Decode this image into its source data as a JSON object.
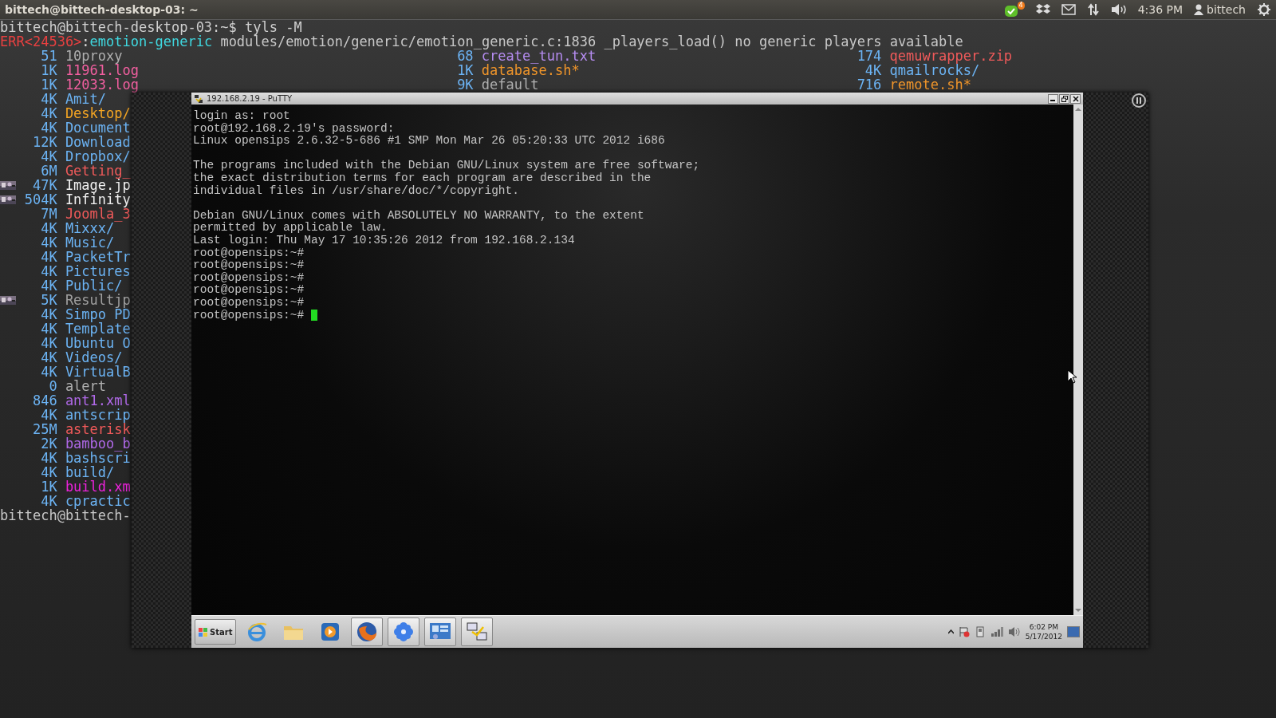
{
  "top_panel": {
    "title": "bittech@bittech-desktop-03: ~",
    "chat_badge": "4",
    "clock": "4:36 PM",
    "user": "bittech"
  },
  "terminal": {
    "prompt_line": "bittech@bittech-desktop-03:~$ tyls -M",
    "error": {
      "tag": "ERR<24536>",
      "separator": ":",
      "module": "emotion-generic",
      "message": "modules/emotion/generic/emotion_generic.c:1836 _players_load() no generic players available"
    },
    "listing": [
      [
        {
          "size": "51",
          "name": "10proxy",
          "kind": "plain"
        },
        {
          "size": "1K",
          "name": "11961.log",
          "kind": "log"
        },
        {
          "size": "1K",
          "name": "12033.log",
          "kind": "log"
        },
        {
          "size": "4K",
          "name": "Amit/",
          "kind": "dir"
        },
        {
          "size": "4K",
          "name": "Desktop/",
          "kind": "highlight"
        },
        {
          "size": "4K",
          "name": "Document",
          "kind": "dir"
        },
        {
          "size": "12K",
          "name": "Download",
          "kind": "dir"
        },
        {
          "size": "4K",
          "name": "Dropbox/",
          "kind": "dir"
        },
        {
          "size": "6M",
          "name": "Getting_",
          "kind": "archive"
        },
        {
          "size": "47K",
          "name": "Image.jp"
        },
        {
          "size": "504K",
          "name": "Infinity"
        },
        {
          "size": "7M",
          "name": "Joomla_3",
          "kind": "archive"
        },
        {
          "size": "4K",
          "name": "Mixxx/",
          "kind": "dir"
        },
        {
          "size": "4K",
          "name": "Music/",
          "kind": "dir"
        },
        {
          "size": "4K",
          "name": "PacketTr",
          "kind": "dir"
        },
        {
          "size": "4K",
          "name": "Pictures",
          "kind": "dir"
        },
        {
          "size": "4K",
          "name": "Public/",
          "kind": "dir"
        },
        {
          "size": "5K",
          "name": "Resultjp",
          "kind": "media"
        },
        {
          "size": "4K",
          "name": "Simpo PD",
          "kind": "dir"
        },
        {
          "size": "4K",
          "name": "Template",
          "kind": "dir"
        },
        {
          "size": "4K",
          "name": "Ubuntu O",
          "kind": "dir"
        },
        {
          "size": "4K",
          "name": "Videos/",
          "kind": "dir"
        },
        {
          "size": "4K",
          "name": "VirtualB",
          "kind": "dir"
        },
        {
          "size": "0",
          "name": "alert",
          "kind": "plain"
        },
        {
          "size": "846",
          "name": "ant1.xml",
          "kind": "xml"
        },
        {
          "size": "4K",
          "name": "antscrip",
          "kind": "dir"
        },
        {
          "size": "25M",
          "name": "asterisk",
          "kind": "archive"
        },
        {
          "size": "2K",
          "name": "bamboo_b",
          "kind": "xml"
        },
        {
          "size": "4K",
          "name": "bashscri",
          "kind": "dir"
        },
        {
          "size": "4K",
          "name": "build/",
          "kind": "dir"
        },
        {
          "size": "1K",
          "name": "build.xm",
          "kind": "build"
        },
        {
          "size": "4K",
          "name": "cpractic",
          "kind": "dir"
        }
      ],
      [
        {
          "size": "68",
          "name": "create_tun.txt",
          "kind": "text"
        },
        {
          "size": "1K",
          "name": "database.sh*",
          "kind": "script"
        },
        {
          "size": "9K",
          "name": "default",
          "kind": "plain"
        }
      ],
      [
        {
          "size": "174",
          "name": "qemuwrapper.zip",
          "kind": "archive"
        },
        {
          "size": "4K",
          "name": "qmailrocks/",
          "kind": "dir"
        },
        {
          "size": "716",
          "name": "remote.sh*",
          "kind": "script"
        }
      ]
    ],
    "next_prompt": "bittech@bittech-"
  },
  "putty": {
    "title": "192.168.2.19 - PuTTY",
    "blocks": [
      [
        "login as: root",
        "root@192.168.2.19's password:",
        "Linux opensips 2.6.32-5-686 #1 SMP Mon Mar 26 05:20:33 UTC 2012 i686"
      ],
      [
        "The programs included with the Debian GNU/Linux system are free software;",
        "the exact distribution terms for each program are described in the",
        "individual files in /usr/share/doc/*/copyright."
      ],
      [
        "Debian GNU/Linux comes with ABSOLUTELY NO WARRANTY, to the extent",
        "permitted by applicable law.",
        "Last login: Thu May 17 10:35:26 2012 from 192.168.2.134",
        "root@opensips:~#",
        "root@opensips:~#",
        "root@opensips:~#",
        "root@opensips:~#",
        "root@opensips:~#",
        "root@opensips:~#"
      ]
    ],
    "cursor": true
  },
  "taskbar": {
    "start": "Start",
    "apps": [
      {
        "kind": "ie",
        "running": false
      },
      {
        "kind": "folder",
        "running": false
      },
      {
        "kind": "media",
        "running": false
      },
      {
        "kind": "firefox",
        "running": true
      },
      {
        "kind": "flower",
        "running": true
      },
      {
        "kind": "dashboard",
        "running": true
      },
      {
        "kind": "putty",
        "running": true
      }
    ],
    "time": "6:02 PM",
    "date": "5/17/2012"
  }
}
